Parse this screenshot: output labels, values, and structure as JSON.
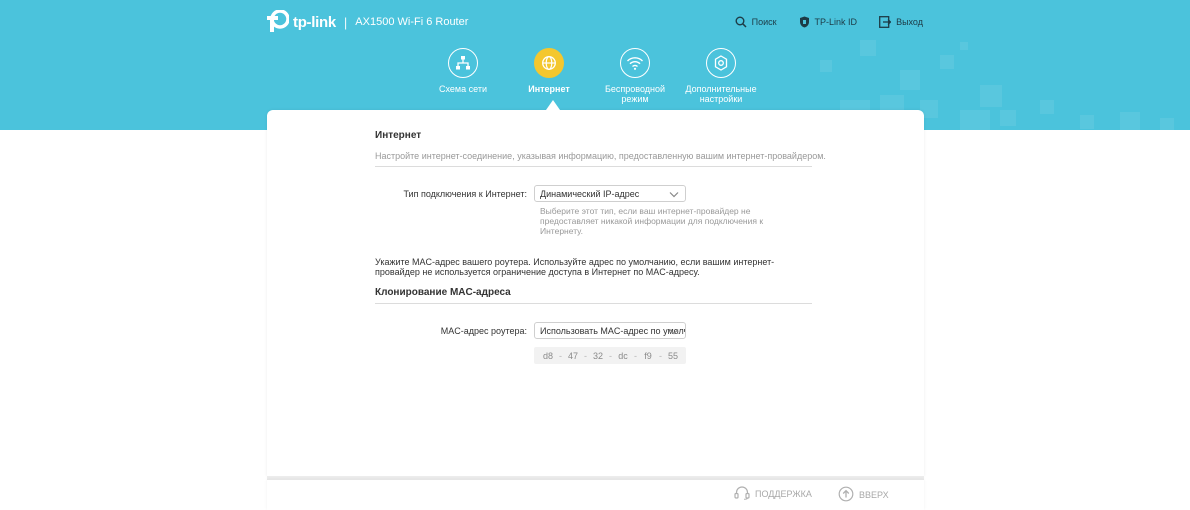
{
  "header": {
    "brand": "tp-link",
    "separator": "|",
    "model": "AX1500 Wi-Fi 6 Router",
    "top_links": [
      {
        "label": "Поиск",
        "icon": "search-icon"
      },
      {
        "label": "TP-Link ID",
        "icon": "tplink-id-icon"
      },
      {
        "label": "Выход",
        "icon": "logout-icon"
      }
    ],
    "nav": [
      {
        "label": "Схема сети",
        "icon": "network-map-icon",
        "active": false
      },
      {
        "label": "Интернет",
        "icon": "globe-icon",
        "active": true
      },
      {
        "label": "Беспроводной режим",
        "icon": "wifi-icon",
        "active": false
      },
      {
        "label": "Дополнительные настройки",
        "icon": "gear-icon",
        "active": false
      }
    ]
  },
  "internet": {
    "title": "Интернет",
    "description": "Настройте интернет-соединение, указывая информацию, предоставленную вашим интернет-провайдером.",
    "connection_type_label": "Тип подключения к Интернет:",
    "connection_type_value": "Динамический IP-адрес",
    "connection_type_help": "Выберите этот тип, если ваш интернет-провайдер не предоставляет никакой информации для подключения к Интернету."
  },
  "mac_clone": {
    "intro": "Укажите MAC-адрес вашего роутера. Используйте адрес по умолчанию, если вашим интернет-провайдер не используется ограничение доступа в Интернет по MAC-адресу.",
    "title": "Клонирование MAC-адреса",
    "label": "MAC-адрес роутера:",
    "select_value": "Использовать MAC-адрес по умолчанию",
    "octets": [
      "d8",
      "47",
      "32",
      "dc",
      "f9",
      "55"
    ],
    "separator": "-"
  },
  "footer": {
    "support_label": "ПОДДЕРЖКА",
    "top_label": "ВВЕРХ"
  },
  "colors": {
    "header_bg": "#4bc3dc",
    "active_nav": "#f4c72e"
  }
}
